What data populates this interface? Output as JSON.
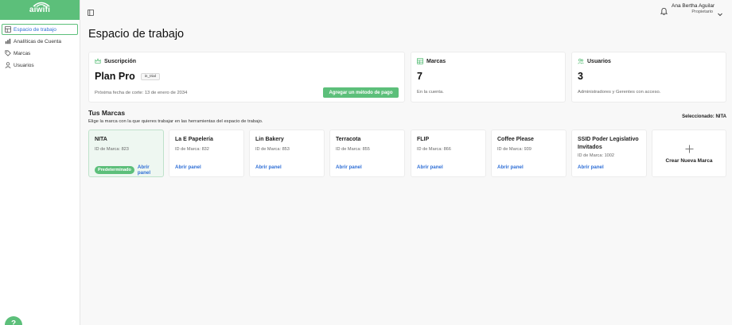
{
  "app": {
    "logo_text": "aiwifi"
  },
  "sidebar": {
    "items": [
      {
        "label": "Espacio de trabajo",
        "icon": "grid-icon"
      },
      {
        "label": "Analíticas de Cuenta",
        "icon": "bar-chart-icon"
      },
      {
        "label": "Marcas",
        "icon": "tags-icon"
      },
      {
        "label": "Usuarios",
        "icon": "user-icon"
      }
    ]
  },
  "header": {
    "user_name": "Ana Bertha Aguilar",
    "user_role": "Propietario"
  },
  "page": {
    "title": "Espacio de trabajo"
  },
  "subscription": {
    "heading": "Suscripción",
    "plan_name": "Plan Pro",
    "plan_status": "in_trial",
    "next_date": "Próxima fecha de corte: 13 de enero de 2034",
    "pay_button": "Agregar un método de pago"
  },
  "stats": {
    "brands": {
      "heading": "Marcas",
      "value": "7",
      "desc": "En la cuenta."
    },
    "users": {
      "heading": "Usuarios",
      "value": "3",
      "desc": "Administradores y Gerentes con acceso."
    }
  },
  "brands_section": {
    "title": "Tus Marcas",
    "subtitle": "Elige la marca con la que quieres trabajar en las herramientas del espacio de trabajo.",
    "selected": "Seleccionado: NITA",
    "default_badge": "Predeterminado",
    "open_label": "Abrir panel",
    "create_label": "Crear Nueva Marca",
    "brands": [
      {
        "name": "NITA",
        "id": "ID de Marca: 823"
      },
      {
        "name": "La E Papelería",
        "id": "ID de Marca: 832"
      },
      {
        "name": "Lin Bakery",
        "id": "ID de Marca: 853"
      },
      {
        "name": "Terracota",
        "id": "ID de Marca: 855"
      },
      {
        "name": "FLIP",
        "id": "ID de Marca: 866"
      },
      {
        "name": "Coffee Please",
        "id": "ID de Marca: 939"
      },
      {
        "name": "SSID Poder Legislativo Invitados",
        "id": "ID de Marca: 1002"
      }
    ]
  },
  "help": {
    "label": "?"
  },
  "colors": {
    "accent": "#5cbf7a",
    "link": "#2f6fd6"
  }
}
